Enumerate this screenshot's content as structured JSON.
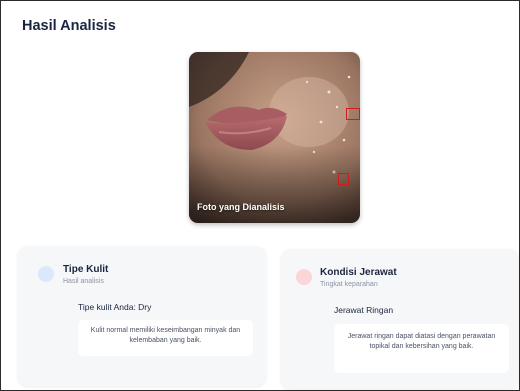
{
  "page": {
    "title": "Hasil Analisis"
  },
  "photo": {
    "caption": "Foto yang Dianalisis"
  },
  "skin_type": {
    "heading": "Tipe Kulit",
    "subheading": "Hasil analisis",
    "value": "Tipe kulit Anda: Dry",
    "description": "Kulit normal memiliki keseimbangan minyak dan kelembaban yang baik."
  },
  "acne_condition": {
    "heading": "Kondisi Jerawat",
    "subheading": "Tingkat keparahan",
    "value": "Jerawat Ringan",
    "description": "Jerawat ringan dapat diatasi dengan perawatan topikal dan kebersihan yang baik."
  },
  "colors": {
    "skin_dot": "#dbe8fb",
    "acne_dot": "#fbd6d6",
    "detection_box": "#d01c1c"
  }
}
